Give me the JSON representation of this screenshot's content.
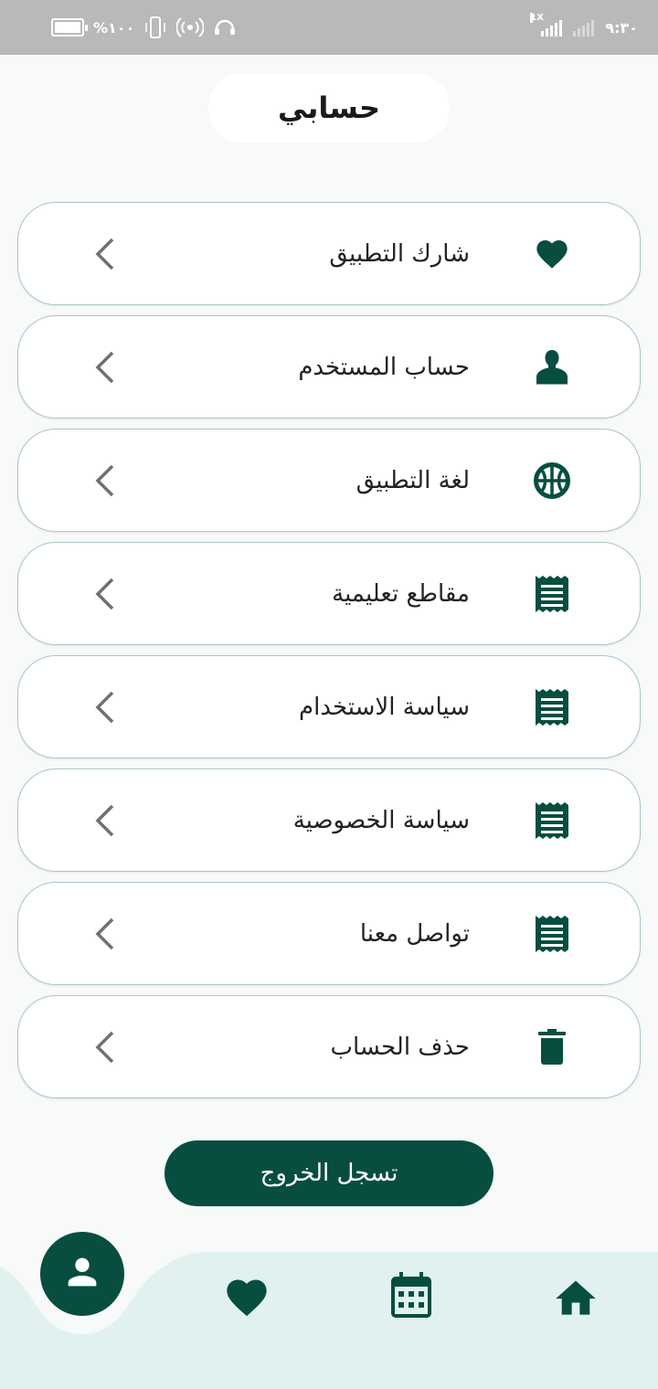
{
  "status_bar": {
    "time": "٩:٣٠",
    "battery_text": "%١٠٠",
    "network_tag": "1X",
    "battery_level": 1.0
  },
  "header": {
    "title": "حسابي"
  },
  "menu": {
    "items": [
      {
        "label": "شارك التطبيق",
        "icon": "heart-icon"
      },
      {
        "label": "حساب المستخدم",
        "icon": "user-icon"
      },
      {
        "label": "لغة التطبيق",
        "icon": "globe-icon"
      },
      {
        "label": "مقاطع تعليمية",
        "icon": "receipt-icon"
      },
      {
        "label": "سياسة الاستخدام",
        "icon": "receipt-icon"
      },
      {
        "label": "سياسة الخصوصية",
        "icon": "receipt-icon"
      },
      {
        "label": "تواصل معنا",
        "icon": "receipt-icon"
      },
      {
        "label": "حذف الحساب",
        "icon": "trash-icon"
      }
    ]
  },
  "logout": {
    "label": "تسجل الخروج"
  },
  "bottom_nav": {
    "items": [
      {
        "icon": "profile-icon",
        "active": true
      },
      {
        "icon": "heart-icon",
        "active": false
      },
      {
        "icon": "calendar-icon",
        "active": false
      },
      {
        "icon": "home-icon",
        "active": false
      }
    ]
  },
  "colors": {
    "primary": "#074e40",
    "card_border": "#a9c8bf",
    "background": "#f8f9f9",
    "nav_background": "#e1f1f0",
    "status_bar": "#b9b9b9"
  }
}
